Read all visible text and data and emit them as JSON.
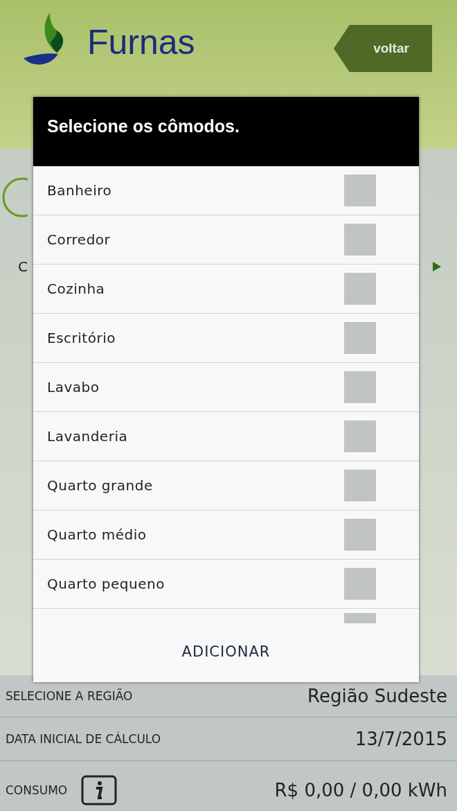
{
  "header": {
    "logo_text": "Furnas",
    "back_button": "voltar"
  },
  "background": {
    "partial_label": "C"
  },
  "dialog": {
    "title": "Selecione os cômodos.",
    "items": [
      {
        "label": "Banheiro",
        "checked": false
      },
      {
        "label": "Corredor",
        "checked": false
      },
      {
        "label": "Cozinha",
        "checked": false
      },
      {
        "label": "Escritório",
        "checked": false
      },
      {
        "label": "Lavabo",
        "checked": false
      },
      {
        "label": "Lavanderia",
        "checked": false
      },
      {
        "label": "Quarto grande",
        "checked": false
      },
      {
        "label": "Quarto médio",
        "checked": false
      },
      {
        "label": "Quarto pequeno",
        "checked": false
      }
    ],
    "partial_item": {
      "checked": false
    },
    "button": "ADICIONAR"
  },
  "fields": [
    {
      "label": "SELECIONE A REGIÃO",
      "value": "Região Sudeste",
      "info": false
    },
    {
      "label": "DATA INICIAL DE CÁLCULO",
      "value": "13/7/2015",
      "info": false
    },
    {
      "label": "CONSUMO",
      "value": "R$ 0,00 / 0,00 kWh",
      "info": true
    }
  ]
}
